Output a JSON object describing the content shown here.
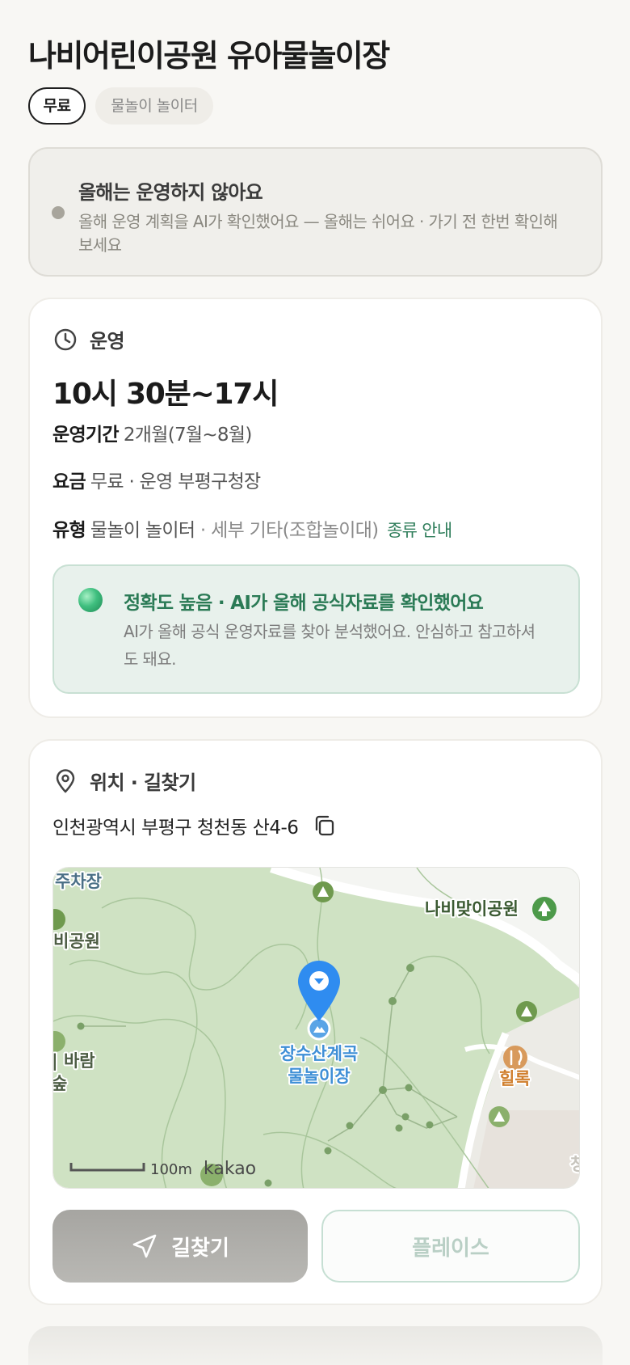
{
  "header": {
    "title": "나비어린이공원 유아물놀이장",
    "tags": [
      "무료",
      "물놀이 놀이터"
    ]
  },
  "notice": {
    "title": "올해는 운영하지 않아요",
    "description": "올해 운영 계획을 AI가 확인했어요 — 올해는 쉬어요 · 가기 전 한번 확인해보세요"
  },
  "hours": {
    "section_label": "운영",
    "time": "10시 30분~17시",
    "period_label": "운영기간",
    "period_value": "2개월(7월~8월)",
    "fee_label": "요금",
    "fee_value": "무료 · 운영 부평구청장",
    "type_label": "유형",
    "type_value": "물놀이 놀이터",
    "type_detail": " · 세부 기타(조합놀이대)",
    "type_link": "종류 안내",
    "accuracy_title": "정확도 높음 · AI가 올해 공식자료를 확인했어요",
    "accuracy_desc": "AI가 올해 공식 운영자료를 찾아 분석했어요. 안심하고 참고하셔도 돼요."
  },
  "location": {
    "section_label": "위치 · 길찾기",
    "address": "인천광역시 부평구 청천동 산4-6",
    "map": {
      "labels": {
        "parking": "주차장",
        "park_left": "비공원",
        "wind_1": "| 바람",
        "wind_2": "숲",
        "nabi_park": "나비맞이공원",
        "target_1": "장수산계곡",
        "target_2": "물놀이장",
        "restaurant": "힐록",
        "scale": "100m",
        "brand": "kakao",
        "edge": "청"
      }
    },
    "nav_button": "길찾기",
    "place_button": "플레이스"
  },
  "colors": {
    "accent_green": "#2e7d5a",
    "pin_blue": "#2f8cf0",
    "map_green": "#cfe2c3"
  }
}
